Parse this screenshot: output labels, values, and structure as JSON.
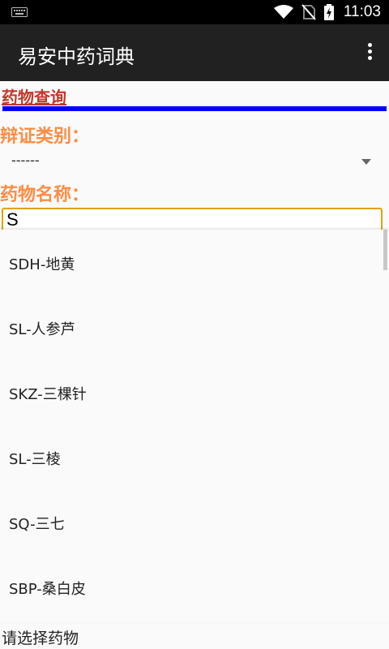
{
  "status_bar": {
    "time": "11:03",
    "icons": [
      "keyboard-icon",
      "wifi-icon",
      "no-sim-icon",
      "battery-charging-icon"
    ]
  },
  "action_bar": {
    "title": "易安中药词典",
    "overflow_icon": "more-vert-icon"
  },
  "section_title": "药物查询",
  "category": {
    "label": "辩证类别：",
    "selected": "------"
  },
  "drug_name": {
    "label": "药物名称：",
    "value": "S"
  },
  "suggestions": [
    "SDH-地黄",
    "SL-人参芦",
    "SKZ-三棵针",
    "SL-三棱",
    "SQ-三七",
    "SBP-桑白皮"
  ],
  "bottom_hint": "请选择药物",
  "colors": {
    "accent_title": "#c0392b",
    "label_orange": "#ff8c42",
    "divider_blue": "#0000ff",
    "input_border": "#e0a200",
    "action_bar": "#212121"
  }
}
